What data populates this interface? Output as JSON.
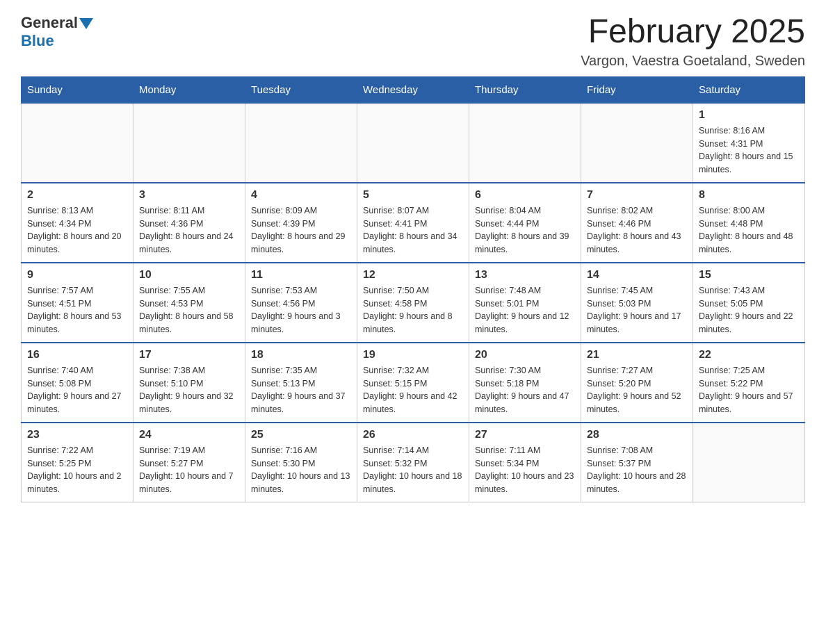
{
  "header": {
    "logo_general": "General",
    "logo_blue": "Blue",
    "month_title": "February 2025",
    "location": "Vargon, Vaestra Goetaland, Sweden"
  },
  "weekdays": [
    "Sunday",
    "Monday",
    "Tuesday",
    "Wednesday",
    "Thursday",
    "Friday",
    "Saturday"
  ],
  "weeks": [
    [
      {
        "day": "",
        "info": ""
      },
      {
        "day": "",
        "info": ""
      },
      {
        "day": "",
        "info": ""
      },
      {
        "day": "",
        "info": ""
      },
      {
        "day": "",
        "info": ""
      },
      {
        "day": "",
        "info": ""
      },
      {
        "day": "1",
        "info": "Sunrise: 8:16 AM\nSunset: 4:31 PM\nDaylight: 8 hours and 15 minutes."
      }
    ],
    [
      {
        "day": "2",
        "info": "Sunrise: 8:13 AM\nSunset: 4:34 PM\nDaylight: 8 hours and 20 minutes."
      },
      {
        "day": "3",
        "info": "Sunrise: 8:11 AM\nSunset: 4:36 PM\nDaylight: 8 hours and 24 minutes."
      },
      {
        "day": "4",
        "info": "Sunrise: 8:09 AM\nSunset: 4:39 PM\nDaylight: 8 hours and 29 minutes."
      },
      {
        "day": "5",
        "info": "Sunrise: 8:07 AM\nSunset: 4:41 PM\nDaylight: 8 hours and 34 minutes."
      },
      {
        "day": "6",
        "info": "Sunrise: 8:04 AM\nSunset: 4:44 PM\nDaylight: 8 hours and 39 minutes."
      },
      {
        "day": "7",
        "info": "Sunrise: 8:02 AM\nSunset: 4:46 PM\nDaylight: 8 hours and 43 minutes."
      },
      {
        "day": "8",
        "info": "Sunrise: 8:00 AM\nSunset: 4:48 PM\nDaylight: 8 hours and 48 minutes."
      }
    ],
    [
      {
        "day": "9",
        "info": "Sunrise: 7:57 AM\nSunset: 4:51 PM\nDaylight: 8 hours and 53 minutes."
      },
      {
        "day": "10",
        "info": "Sunrise: 7:55 AM\nSunset: 4:53 PM\nDaylight: 8 hours and 58 minutes."
      },
      {
        "day": "11",
        "info": "Sunrise: 7:53 AM\nSunset: 4:56 PM\nDaylight: 9 hours and 3 minutes."
      },
      {
        "day": "12",
        "info": "Sunrise: 7:50 AM\nSunset: 4:58 PM\nDaylight: 9 hours and 8 minutes."
      },
      {
        "day": "13",
        "info": "Sunrise: 7:48 AM\nSunset: 5:01 PM\nDaylight: 9 hours and 12 minutes."
      },
      {
        "day": "14",
        "info": "Sunrise: 7:45 AM\nSunset: 5:03 PM\nDaylight: 9 hours and 17 minutes."
      },
      {
        "day": "15",
        "info": "Sunrise: 7:43 AM\nSunset: 5:05 PM\nDaylight: 9 hours and 22 minutes."
      }
    ],
    [
      {
        "day": "16",
        "info": "Sunrise: 7:40 AM\nSunset: 5:08 PM\nDaylight: 9 hours and 27 minutes."
      },
      {
        "day": "17",
        "info": "Sunrise: 7:38 AM\nSunset: 5:10 PM\nDaylight: 9 hours and 32 minutes."
      },
      {
        "day": "18",
        "info": "Sunrise: 7:35 AM\nSunset: 5:13 PM\nDaylight: 9 hours and 37 minutes."
      },
      {
        "day": "19",
        "info": "Sunrise: 7:32 AM\nSunset: 5:15 PM\nDaylight: 9 hours and 42 minutes."
      },
      {
        "day": "20",
        "info": "Sunrise: 7:30 AM\nSunset: 5:18 PM\nDaylight: 9 hours and 47 minutes."
      },
      {
        "day": "21",
        "info": "Sunrise: 7:27 AM\nSunset: 5:20 PM\nDaylight: 9 hours and 52 minutes."
      },
      {
        "day": "22",
        "info": "Sunrise: 7:25 AM\nSunset: 5:22 PM\nDaylight: 9 hours and 57 minutes."
      }
    ],
    [
      {
        "day": "23",
        "info": "Sunrise: 7:22 AM\nSunset: 5:25 PM\nDaylight: 10 hours and 2 minutes."
      },
      {
        "day": "24",
        "info": "Sunrise: 7:19 AM\nSunset: 5:27 PM\nDaylight: 10 hours and 7 minutes."
      },
      {
        "day": "25",
        "info": "Sunrise: 7:16 AM\nSunset: 5:30 PM\nDaylight: 10 hours and 13 minutes."
      },
      {
        "day": "26",
        "info": "Sunrise: 7:14 AM\nSunset: 5:32 PM\nDaylight: 10 hours and 18 minutes."
      },
      {
        "day": "27",
        "info": "Sunrise: 7:11 AM\nSunset: 5:34 PM\nDaylight: 10 hours and 23 minutes."
      },
      {
        "day": "28",
        "info": "Sunrise: 7:08 AM\nSunset: 5:37 PM\nDaylight: 10 hours and 28 minutes."
      },
      {
        "day": "",
        "info": ""
      }
    ]
  ]
}
